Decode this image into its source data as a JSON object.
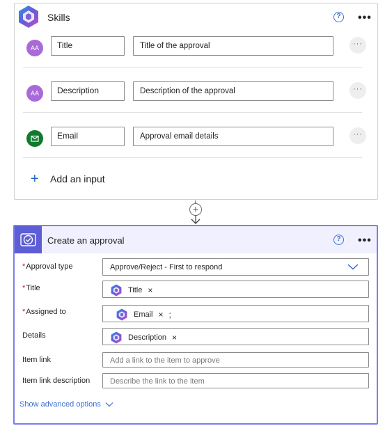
{
  "skills": {
    "title": "Skills",
    "help_glyph": "?",
    "more_glyph": "•••",
    "inputs": [
      {
        "icon": "text-type-icon",
        "icon_text": "AA",
        "name": "Title",
        "description": "Title of the approval",
        "more": "···"
      },
      {
        "icon": "text-type-icon",
        "icon_text": "AA",
        "name": "Description",
        "description": "Description of the approval",
        "more": "···"
      },
      {
        "icon": "email-icon",
        "icon_text": "",
        "name": "Email",
        "description": "Approval email details",
        "more": "···"
      }
    ],
    "add_input_plus": "+",
    "add_input_label": "Add an input"
  },
  "connector": {
    "plus": "+"
  },
  "approval": {
    "title": "Create an approval",
    "help_glyph": "?",
    "more_glyph": "•••",
    "fields": {
      "approval_type": {
        "required": "*",
        "label": "Approval type",
        "value": "Approve/Reject - First to respond"
      },
      "title": {
        "required": "*",
        "label": "Title",
        "token": "Title",
        "remove": "×"
      },
      "assigned_to": {
        "required": "*",
        "label": "Assigned to",
        "token": "Email",
        "remove": "×",
        "separator": ";"
      },
      "details": {
        "label": "Details",
        "token": "Description",
        "remove": "×"
      },
      "item_link": {
        "label": "Item link",
        "placeholder": "Add a link to the item to approve"
      },
      "item_link_description": {
        "label": "Item link description",
        "placeholder": "Describe the link to the item"
      }
    },
    "advanced_label": "Show advanced options"
  },
  "colors": {
    "accent": "#5d5dd6",
    "card_border": "#7d7df1",
    "header_bg": "#f0f0ff",
    "link": "#3b6fd6",
    "required": "#c50f1f",
    "text_icon_bg": "#a86ad9",
    "email_icon_bg": "#0f7b2c"
  }
}
